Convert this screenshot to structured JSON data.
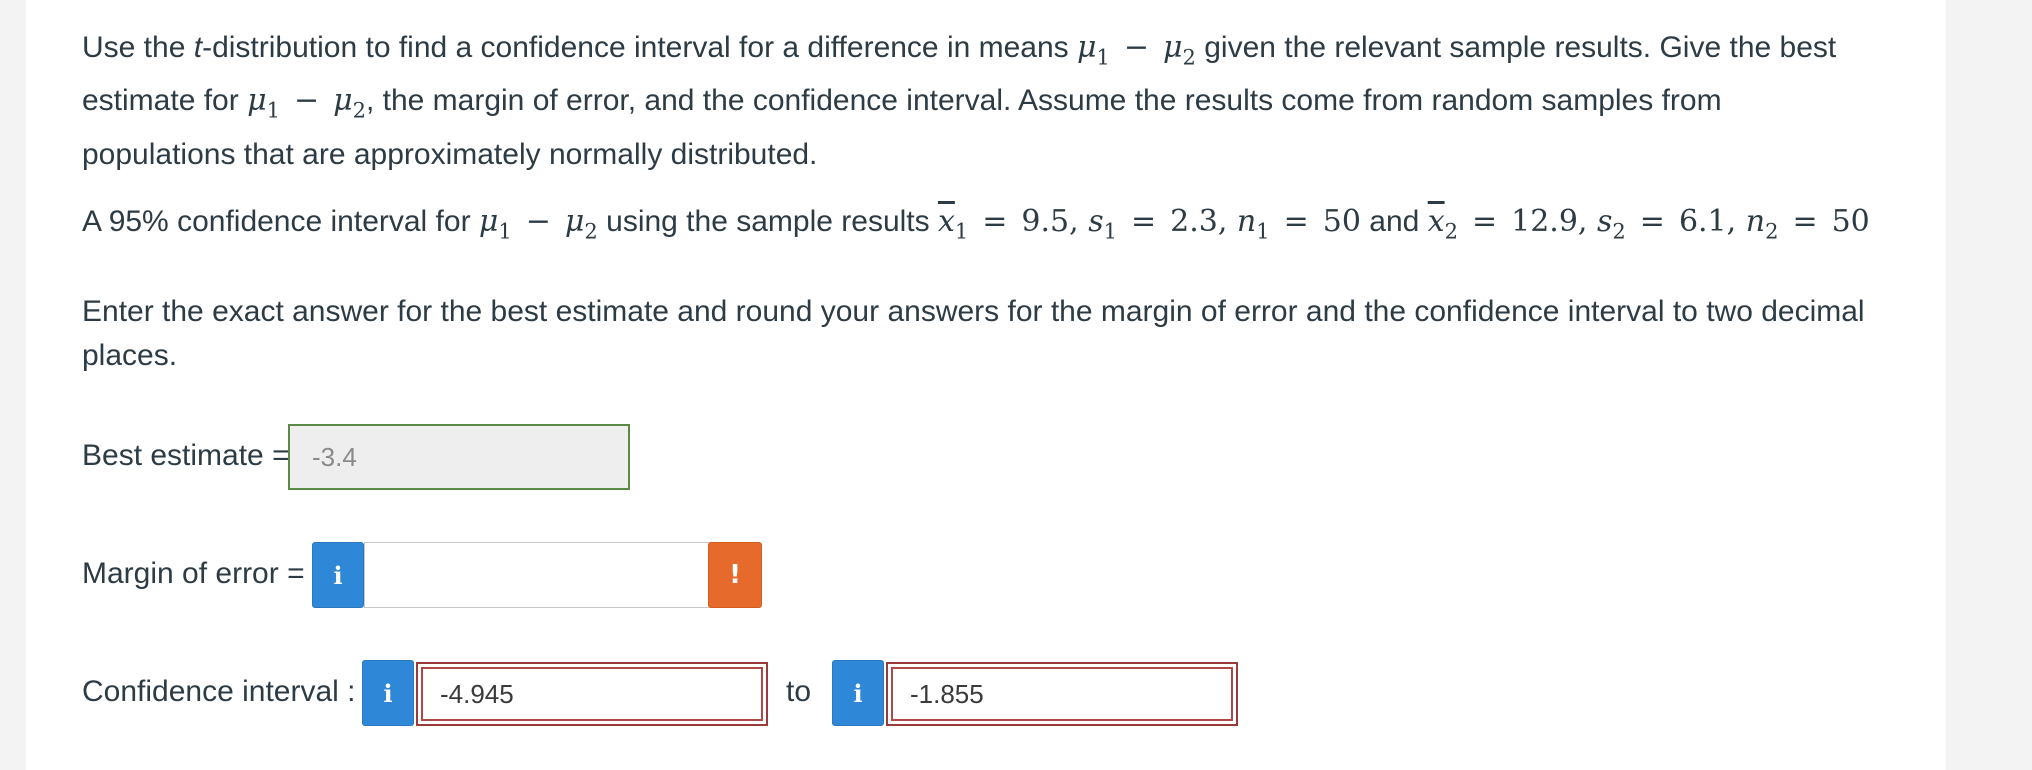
{
  "question": {
    "intro_a": "Use the ",
    "intro_t": "t",
    "intro_b": "-distribution to find a confidence interval for a difference in means ",
    "intro_c": " given the relevant sample results. Give the best",
    "line2_a": "estimate for ",
    "line2_b": ", the margin of error, and the confidence interval. Assume the results come from random samples from",
    "line3": "populations that are approximately normally distributed.",
    "setup_a": "A 95% confidence interval for ",
    "setup_b": " using the sample results ",
    "and": " and ",
    "instructions": "Enter the exact answer for the best estimate and round your answers for the margin of error and the confidence interval to two decimal places."
  },
  "math": {
    "mu": "μ",
    "sub1": "1",
    "sub2": "2",
    "minus": "−",
    "xbar": "x",
    "s": "s",
    "n": "n",
    "eq": "=",
    "x1_val": "9.5,",
    "s1_val": "2.3,",
    "n1_val": "50",
    "x2_val": "12.9,",
    "s2_val": "6.1,",
    "n2_val": "50"
  },
  "answers": {
    "best_estimate_label": "Best estimate =",
    "best_estimate_value": "-3.4",
    "margin_label": "Margin of error =",
    "margin_value": "",
    "ci_label": "Confidence interval :",
    "ci_lower": "-4.945",
    "ci_to": "to",
    "ci_upper": "-1.855"
  },
  "icons": {
    "info": "i",
    "warning": "!"
  },
  "colors": {
    "info_blue": "#2f87d8",
    "warning_orange": "#e66a2c",
    "correct_green": "#5a8a46",
    "error_red": "#9b3a3a"
  }
}
